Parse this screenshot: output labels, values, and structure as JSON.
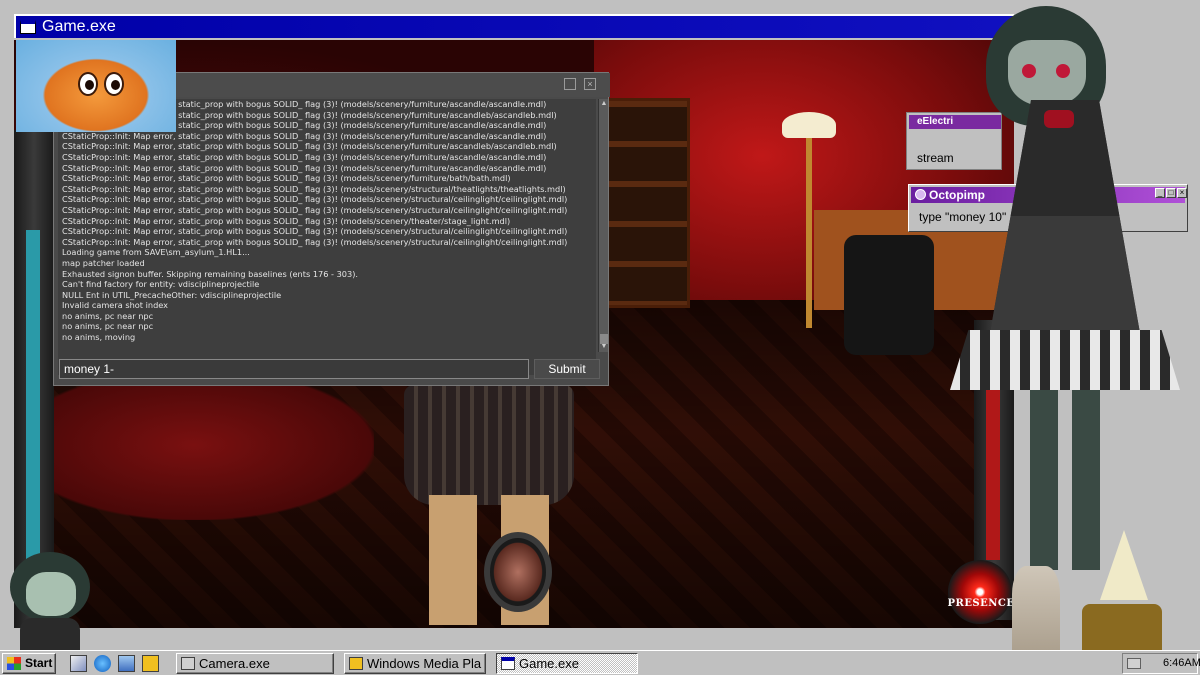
{
  "game_window": {
    "title": "Game.exe"
  },
  "console": {
    "log_lines": [
      "CStaticProp::Init:  Map error, static_prop with bogus SOLID_ flag (3)! (models/scenery/furniture/ascandle/ascandle.mdl)",
      "CStaticProp::Init:  Map error, static_prop with bogus SOLID_ flag (3)! (models/scenery/furniture/ascandleb/ascandleb.mdl)",
      "CStaticProp::Init:  Map error, static_prop with bogus SOLID_ flag (3)! (models/scenery/furniture/ascandle/ascandle.mdl)",
      "CStaticProp::Init:  Map error, static_prop with bogus SOLID_ flag (3)! (models/scenery/furniture/ascandle/ascandle.mdl)",
      "CStaticProp::Init:  Map error, static_prop with bogus SOLID_ flag (3)! (models/scenery/furniture/ascandleb/ascandleb.mdl)",
      "CStaticProp::Init:  Map error, static_prop with bogus SOLID_ flag (3)! (models/scenery/furniture/ascandle/ascandle.mdl)",
      "CStaticProp::Init:  Map error, static_prop with bogus SOLID_ flag (3)! (models/scenery/furniture/ascandle/ascandle.mdl)",
      "CStaticProp::Init:  Map error, static_prop with bogus SOLID_ flag (3)! (models/scenery/furniture/bath/bath.mdl)",
      "CStaticProp::Init:  Map error, static_prop with bogus SOLID_ flag (3)! (models/scenery/structural/theatlights/theatlights.mdl)",
      "CStaticProp::Init:  Map error, static_prop with bogus SOLID_ flag (3)! (models/scenery/structural/ceilinglight/ceilinglight.mdl)",
      "CStaticProp::Init:  Map error, static_prop with bogus SOLID_ flag (3)! (models/scenery/structural/ceilinglight/ceilinglight.mdl)",
      "CStaticProp::Init:  Map error, static_prop with bogus SOLID_ flag (3)! (models/scenery/theater/stage_light.mdl)",
      "CStaticProp::Init:  Map error, static_prop with bogus SOLID_ flag (3)! (models/scenery/structural/ceilinglight/ceilinglight.mdl)",
      "CStaticProp::Init:  Map error, static_prop with bogus SOLID_ flag (3)! (models/scenery/structural/ceilinglight/ceilinglight.mdl)",
      "Loading game from SAVE\\sm_asylum_1.HL1...",
      "map patcher loaded",
      "Exhausted signon buffer. Skipping remaining baselines (ents 176 - 303).",
      "Can't find factory for entity: vdisciplineprojectile",
      "NULL Ent in UTIL_PrecacheOther: vdisciplineprojectile",
      "Invalid camera shot index",
      "no anims, pc near npc",
      "no anims, pc near npc",
      "no anims, moving"
    ],
    "input_value": "money 1-",
    "submit_label": "Submit",
    "minimize_glyph": "",
    "close_glyph": "×"
  },
  "hud": {
    "presence_label": "PRESENCE"
  },
  "chat_overlay": {
    "partial_title": "eElectri",
    "partial_message": "stream",
    "popup_title": "Octopimp",
    "popup_message": "type \"money 10\"",
    "popup_buttons": [
      "_",
      "□",
      "×"
    ]
  },
  "taskbar": {
    "start_label": "Start",
    "quick_launch": [
      "desktop-icon",
      "ie-icon",
      "network-icon",
      "media-player-icon"
    ],
    "tasks": [
      {
        "label": "Camera.exe",
        "active": false
      },
      {
        "label": "Windows Media Pla",
        "active": false
      },
      {
        "label": "Game.exe",
        "active": true
      }
    ],
    "clock": "6:46AM"
  },
  "colors": {
    "titlebar": "#0000a8",
    "popup_titlebar": "#6a1ea0",
    "console_bg": "#4a4a4a",
    "taskbar": "#c0c0c0"
  }
}
